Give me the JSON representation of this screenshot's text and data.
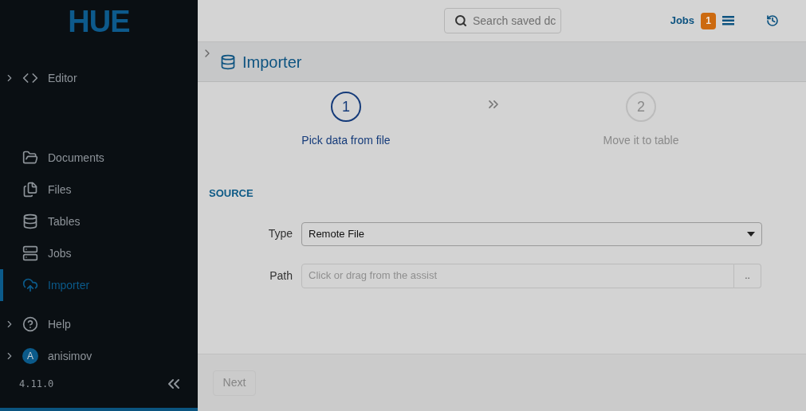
{
  "logo": {
    "text": "HUE"
  },
  "sidebar": {
    "items": [
      {
        "label": "Editor",
        "kind": "expandable",
        "selected": false
      },
      {
        "label": "Documents",
        "kind": "link",
        "selected": false
      },
      {
        "label": "Files",
        "kind": "link",
        "selected": false
      },
      {
        "label": "Tables",
        "kind": "link",
        "selected": false
      },
      {
        "label": "Jobs",
        "kind": "link",
        "selected": false
      },
      {
        "label": "Importer",
        "kind": "link",
        "selected": true
      },
      {
        "label": "Help",
        "kind": "expandable",
        "selected": false
      },
      {
        "label": "anisimov",
        "kind": "expandable",
        "avatar_letter": "A",
        "selected": false
      }
    ],
    "version": "4.11.0"
  },
  "topbar": {
    "search": {
      "placeholder": "Search saved dc"
    },
    "jobs": {
      "label": "Jobs",
      "count": "1"
    }
  },
  "page": {
    "title": "Importer"
  },
  "steps": [
    {
      "number": "1",
      "label": "Pick data from file",
      "selected": true
    },
    {
      "number": "2",
      "label": "Move it to table",
      "selected": false
    }
  ],
  "source": {
    "heading": "SOURCE",
    "fields": [
      {
        "label": "Type",
        "kind": "select",
        "value": "Remote File"
      },
      {
        "label": "Path",
        "kind": "path",
        "placeholder": "Click or drag from the assist",
        "button": ".."
      }
    ]
  },
  "footer": {
    "next": {
      "label": "Next",
      "disabled": true
    }
  }
}
